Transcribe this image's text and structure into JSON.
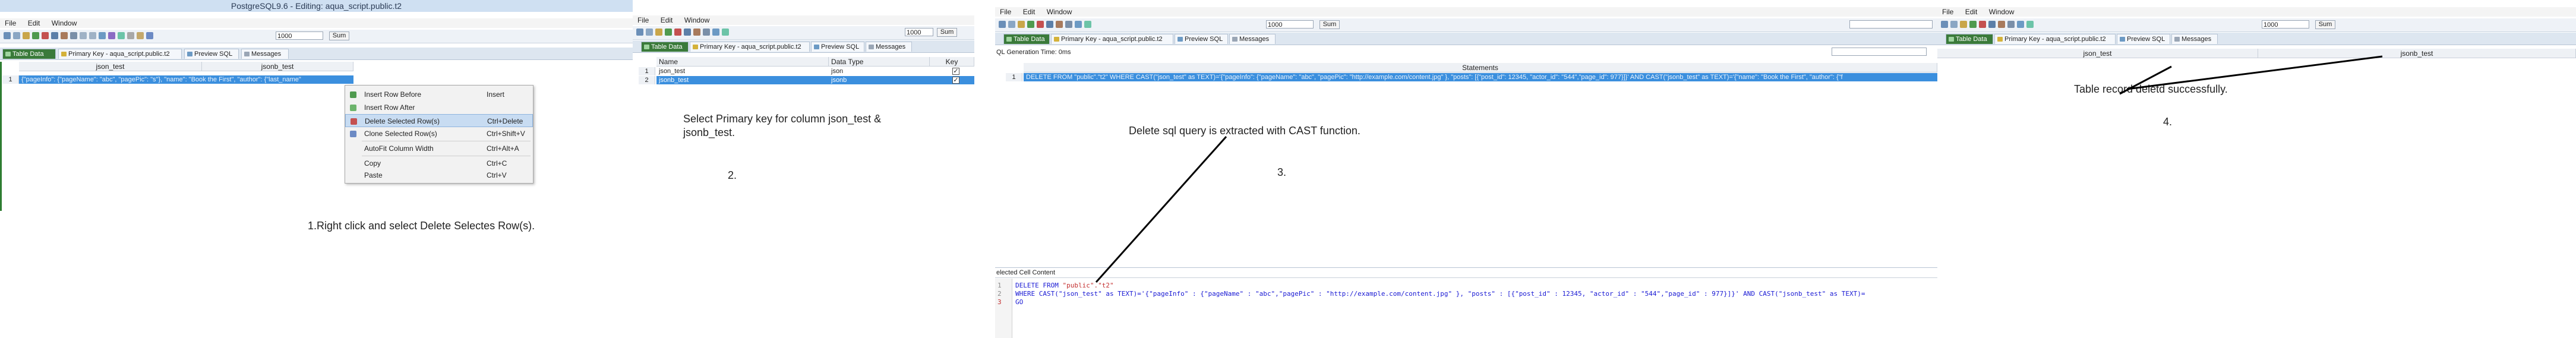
{
  "panel1": {
    "title": "PostgreSQL9.6 - Editing: aqua_script.public.t2",
    "menu": [
      "File",
      "Edit",
      "Window"
    ],
    "toolbar_value": "1000",
    "toolbar_button": "Sum",
    "tabs": [
      "Table Data",
      "Primary Key - aqua_script.public.t2",
      "Preview SQL",
      "Messages"
    ],
    "col_json": "json_test",
    "col_jsonb": "jsonb_test",
    "row_number": "1",
    "row_text": "{\"pageInfo\": {\"pageName\": \"abc\", \"pagePic\": \"s\"}, \"name\": \"Book the First\", \"author\": {\"last_name\"",
    "context_menu": [
      {
        "label": "Insert Row Before",
        "shortcut": "Insert"
      },
      {
        "label": "Insert Row After",
        "shortcut": ""
      },
      {
        "label": "Delete Selected Row(s)",
        "shortcut": "Ctrl+Delete"
      },
      {
        "label": "Clone Selected Row(s)",
        "shortcut": "Ctrl+Shift+V"
      },
      {
        "label": "AutoFit Column Width",
        "shortcut": "Ctrl+Alt+A"
      },
      {
        "label": "Copy",
        "shortcut": "Ctrl+C"
      },
      {
        "label": "Paste",
        "shortcut": "Ctrl+V"
      }
    ],
    "caption": "1.Right click and select Delete Selectes Row(s)."
  },
  "panel2": {
    "menu": [
      "File",
      "Edit",
      "Window"
    ],
    "toolbar_value": "1000",
    "toolbar_button": "Sum",
    "tabs": [
      "Table Data",
      "Primary Key - aqua_script.public.t2",
      "Preview SQL",
      "Messages"
    ],
    "headers": [
      "Name",
      "Data Type",
      "Key"
    ],
    "rows": [
      {
        "num": "1",
        "name": "json_test",
        "type": "json",
        "key": "✓"
      },
      {
        "num": "2",
        "name": "jsonb_test",
        "type": "jsonb",
        "key": "✓"
      }
    ],
    "caption_line1": "Select Primary key for column json_test &",
    "caption_line2": "jsonb_test.",
    "step": "2."
  },
  "panel3": {
    "menu": [
      "File",
      "Edit",
      "Window"
    ],
    "toolbar_value": "1000",
    "toolbar_button": "Sum",
    "tabs": [
      "Table Data",
      "Primary Key - aqua_script.public.t2",
      "Preview SQL",
      "Messages"
    ],
    "generation_time": "QL Generation Time: 0ms",
    "statements_header": "Statements",
    "row_number": "1",
    "row_text": "DELETE FROM \"public\".\"t2\" WHERE CAST(\"json_test\" as TEXT)='{\"pageInfo\": {\"pageName\": \"abc\", \"pagePic\": \"http://example.com/content.jpg\" }, \"posts\": [{\"post_id\": 12345, \"actor_id\": \"544\",\"page_id\": 977}]}' AND CAST(\"jsonb_test\" as TEXT)='{\"name\": \"Book the First\", \"author\": {\"f",
    "caption": "Delete sql query is extracted with CAST function.",
    "step": "3."
  },
  "cell_panel": {
    "label": "elected Cell Content",
    "line_numbers": [
      "1",
      "2",
      "3"
    ],
    "line1_kw": "DELETE FROM ",
    "line1_str": "\"public\".\"t2\"",
    "line2": "WHERE CAST(\"json_test\" as TEXT)='{\"pageInfo\" : {\"pageName\" : \"abc\",\"pagePic\" : \"http://example.com/content.jpg\" }, \"posts\" : [{\"post_id\" : 12345, \"actor_id\" : \"544\",\"page_id\" : 977}]}' AND CAST(\"jsonb_test\" as TEXT)=",
    "line3": "GO"
  },
  "panel4": {
    "menu": [
      "File",
      "Edit",
      "Window"
    ],
    "toolbar_value": "1000",
    "toolbar_button": "Sum",
    "tabs": [
      "Table Data",
      "Primary Key - aqua_script.public.t2",
      "Preview SQL",
      "Messages"
    ],
    "col_json": "json_test",
    "col_jsonb": "jsonb_test",
    "caption": "Table record deletd successfully.",
    "step": "4."
  },
  "colors": {
    "accent_green": "#3a7a3a",
    "selection_blue": "#3b8fde",
    "annotation": "#000000"
  }
}
